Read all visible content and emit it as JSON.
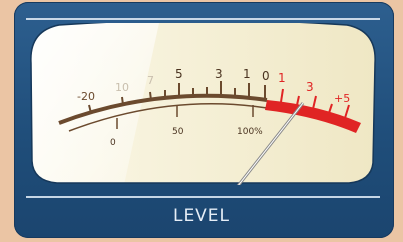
{
  "meter": {
    "label": "LEVEL",
    "db_scale": [
      "-20",
      "10",
      "7",
      "5",
      "3",
      "1",
      "0",
      "1",
      "3",
      "+5"
    ],
    "pct_scale": [
      "0",
      "50",
      "100%"
    ],
    "needle_value_db": 0.5
  },
  "colors": {
    "frame": "#1f4d79",
    "panel_face": "#f6f2d4",
    "scale_normal": "#6b4a2e",
    "scale_red": "#e02424",
    "label_text": "#e6eef7",
    "background": "#ebc5a4"
  }
}
